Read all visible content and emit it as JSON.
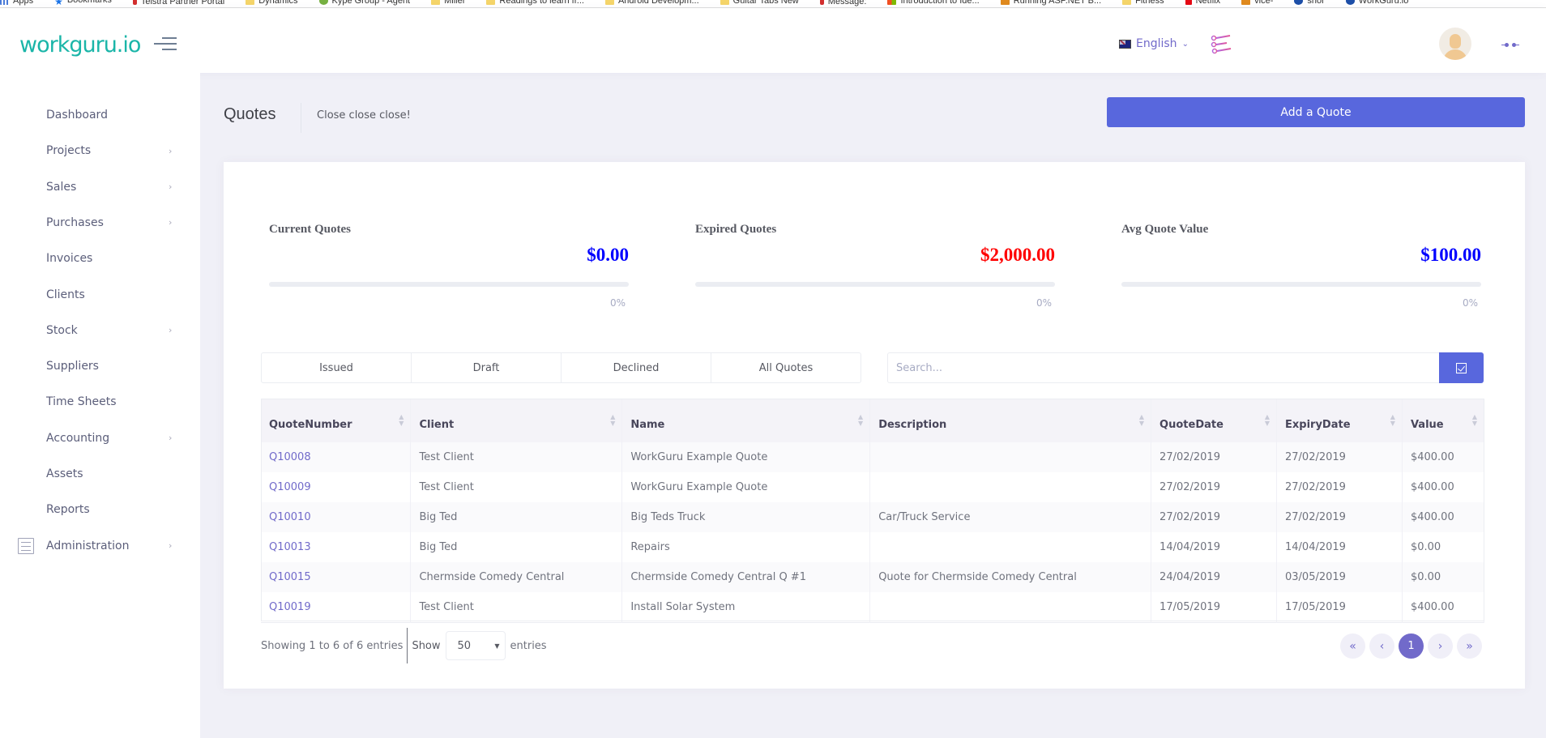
{
  "bookmarks": [
    {
      "label": "Apps",
      "icon": "apps-grid-icon"
    },
    {
      "label": "Bookmarks",
      "icon": "star-icon"
    },
    {
      "label": "Telstra Partner Portal",
      "icon": "telstra-icon"
    },
    {
      "label": "Dynamics",
      "icon": "folder-icon"
    },
    {
      "label": "Kype Group - Agent",
      "icon": "leaf-icon"
    },
    {
      "label": "Miller",
      "icon": "folder-icon"
    },
    {
      "label": "Readings to learn fr...",
      "icon": "folder-icon"
    },
    {
      "label": "Android Developm...",
      "icon": "folder-icon"
    },
    {
      "label": "Guitar Tabs New",
      "icon": "folder-icon"
    },
    {
      "label": "Message:",
      "icon": "telstra-icon"
    },
    {
      "label": "Introduction to Ide...",
      "icon": "microsoft-icon"
    },
    {
      "label": "Running ASP.NET B...",
      "icon": "site-icon"
    },
    {
      "label": "Fitness",
      "icon": "folder-icon"
    },
    {
      "label": "Netflix",
      "icon": "netflix-icon"
    },
    {
      "label": "vice-",
      "icon": "site-icon"
    },
    {
      "label": "shor",
      "icon": "workguru-icon"
    },
    {
      "label": "WorkGuru.io",
      "icon": "workguru-icon"
    }
  ],
  "header": {
    "logo": "workguru.io",
    "language": "English",
    "colors": {
      "logo": "#1ab5a8",
      "accent": "#716aca",
      "primary": "#5867dd"
    }
  },
  "sidebar": {
    "items": [
      {
        "label": "Dashboard",
        "has_submenu": false
      },
      {
        "label": "Projects",
        "has_submenu": true
      },
      {
        "label": "Sales",
        "has_submenu": true
      },
      {
        "label": "Purchases",
        "has_submenu": true
      },
      {
        "label": "Invoices",
        "has_submenu": false
      },
      {
        "label": "Clients",
        "has_submenu": false
      },
      {
        "label": "Stock",
        "has_submenu": true
      },
      {
        "label": "Suppliers",
        "has_submenu": false
      },
      {
        "label": "Time Sheets",
        "has_submenu": false
      },
      {
        "label": "Accounting",
        "has_submenu": true
      },
      {
        "label": "Assets",
        "has_submenu": false
      },
      {
        "label": "Reports",
        "has_submenu": false
      },
      {
        "label": "Administration",
        "has_submenu": true
      }
    ],
    "arrow": "›"
  },
  "page": {
    "title": "Quotes",
    "subtitle": "Close close close!",
    "add_button": "Add a Quote"
  },
  "stats": [
    {
      "title": "Current Quotes",
      "value": "$0.00",
      "color": "#0000ff",
      "progress": 0,
      "progress_label": "0%"
    },
    {
      "title": "Expired Quotes",
      "value": "$2,000.00",
      "color": "#ff0000",
      "progress": 0,
      "progress_label": "0%"
    },
    {
      "title": "Avg Quote Value",
      "value": "$100.00",
      "color": "#0000ff",
      "progress": 0,
      "progress_label": "0%"
    }
  ],
  "filters": {
    "tabs": [
      "Issued",
      "Draft",
      "Declined",
      "All Quotes"
    ],
    "search_placeholder": "Search...",
    "search_value": ""
  },
  "table": {
    "columns": [
      "QuoteNumber",
      "Client",
      "Name",
      "Description",
      "QuoteDate",
      "ExpiryDate",
      "Value"
    ],
    "rows": [
      [
        "Q10008",
        "Test Client",
        "WorkGuru Example Quote",
        "",
        "27/02/2019",
        "27/02/2019",
        "$400.00"
      ],
      [
        "Q10009",
        "Test Client",
        "WorkGuru Example Quote",
        "",
        "27/02/2019",
        "27/02/2019",
        "$400.00"
      ],
      [
        "Q10010",
        "Big Ted",
        "Big Teds Truck",
        "Car/Truck Service",
        "27/02/2019",
        "27/02/2019",
        "$400.00"
      ],
      [
        "Q10013",
        "Big Ted",
        "Repairs",
        "",
        "14/04/2019",
        "14/04/2019",
        "$0.00"
      ],
      [
        "Q10015",
        "Chermside Comedy Central",
        "Chermside Comedy Central Q #1",
        "Quote for Chermside Comedy Central",
        "24/04/2019",
        "03/05/2019",
        "$0.00"
      ],
      [
        "Q10019",
        "Test Client",
        "Install Solar System",
        "",
        "17/05/2019",
        "17/05/2019",
        "$400.00"
      ]
    ]
  },
  "footer": {
    "info": "Showing 1 to 6 of 6 entries",
    "show_label": "Show",
    "page_length": "50",
    "entries_label": "entries",
    "pagination": {
      "first": "«",
      "prev": "‹",
      "current": "1",
      "next": "›",
      "last": "»"
    }
  }
}
